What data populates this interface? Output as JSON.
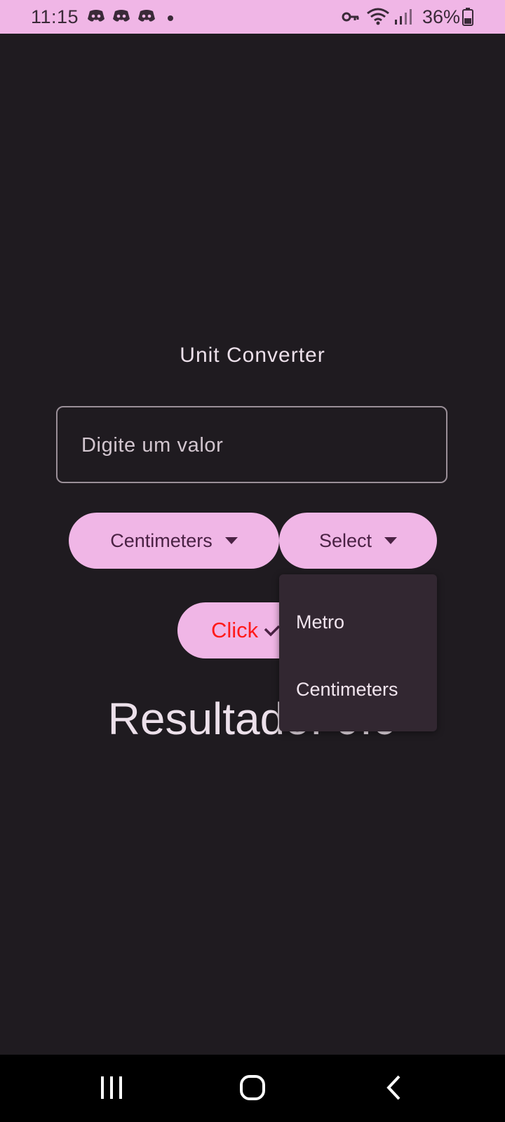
{
  "status_bar": {
    "time": "11:15",
    "battery": "36%",
    "notification_icons": [
      "discord-icon",
      "discord-icon",
      "discord-icon",
      "dot-icon"
    ],
    "system_icons": [
      "key-icon",
      "wifi-icon",
      "signal-icon",
      "battery-icon"
    ]
  },
  "app": {
    "title": "Unit Converter",
    "input": {
      "placeholder": "Digite um valor",
      "value": ""
    },
    "from_unit": {
      "label": "Centimeters"
    },
    "to_unit": {
      "label": "Select"
    },
    "convert_button": {
      "label": "Click"
    },
    "result": "Resultado: 0.0"
  },
  "dropdown_menu": {
    "items": [
      {
        "label": "Metro"
      },
      {
        "label": "Centimeters"
      }
    ]
  },
  "nav_bar": {
    "buttons": [
      "recents-icon",
      "home-icon",
      "back-icon"
    ]
  },
  "colors": {
    "background": "#1f1b20",
    "accent": "#f0b6e6",
    "button_text": "#4a2244",
    "convert_label": "#ff1a1a",
    "menu_surface": "#322731"
  }
}
